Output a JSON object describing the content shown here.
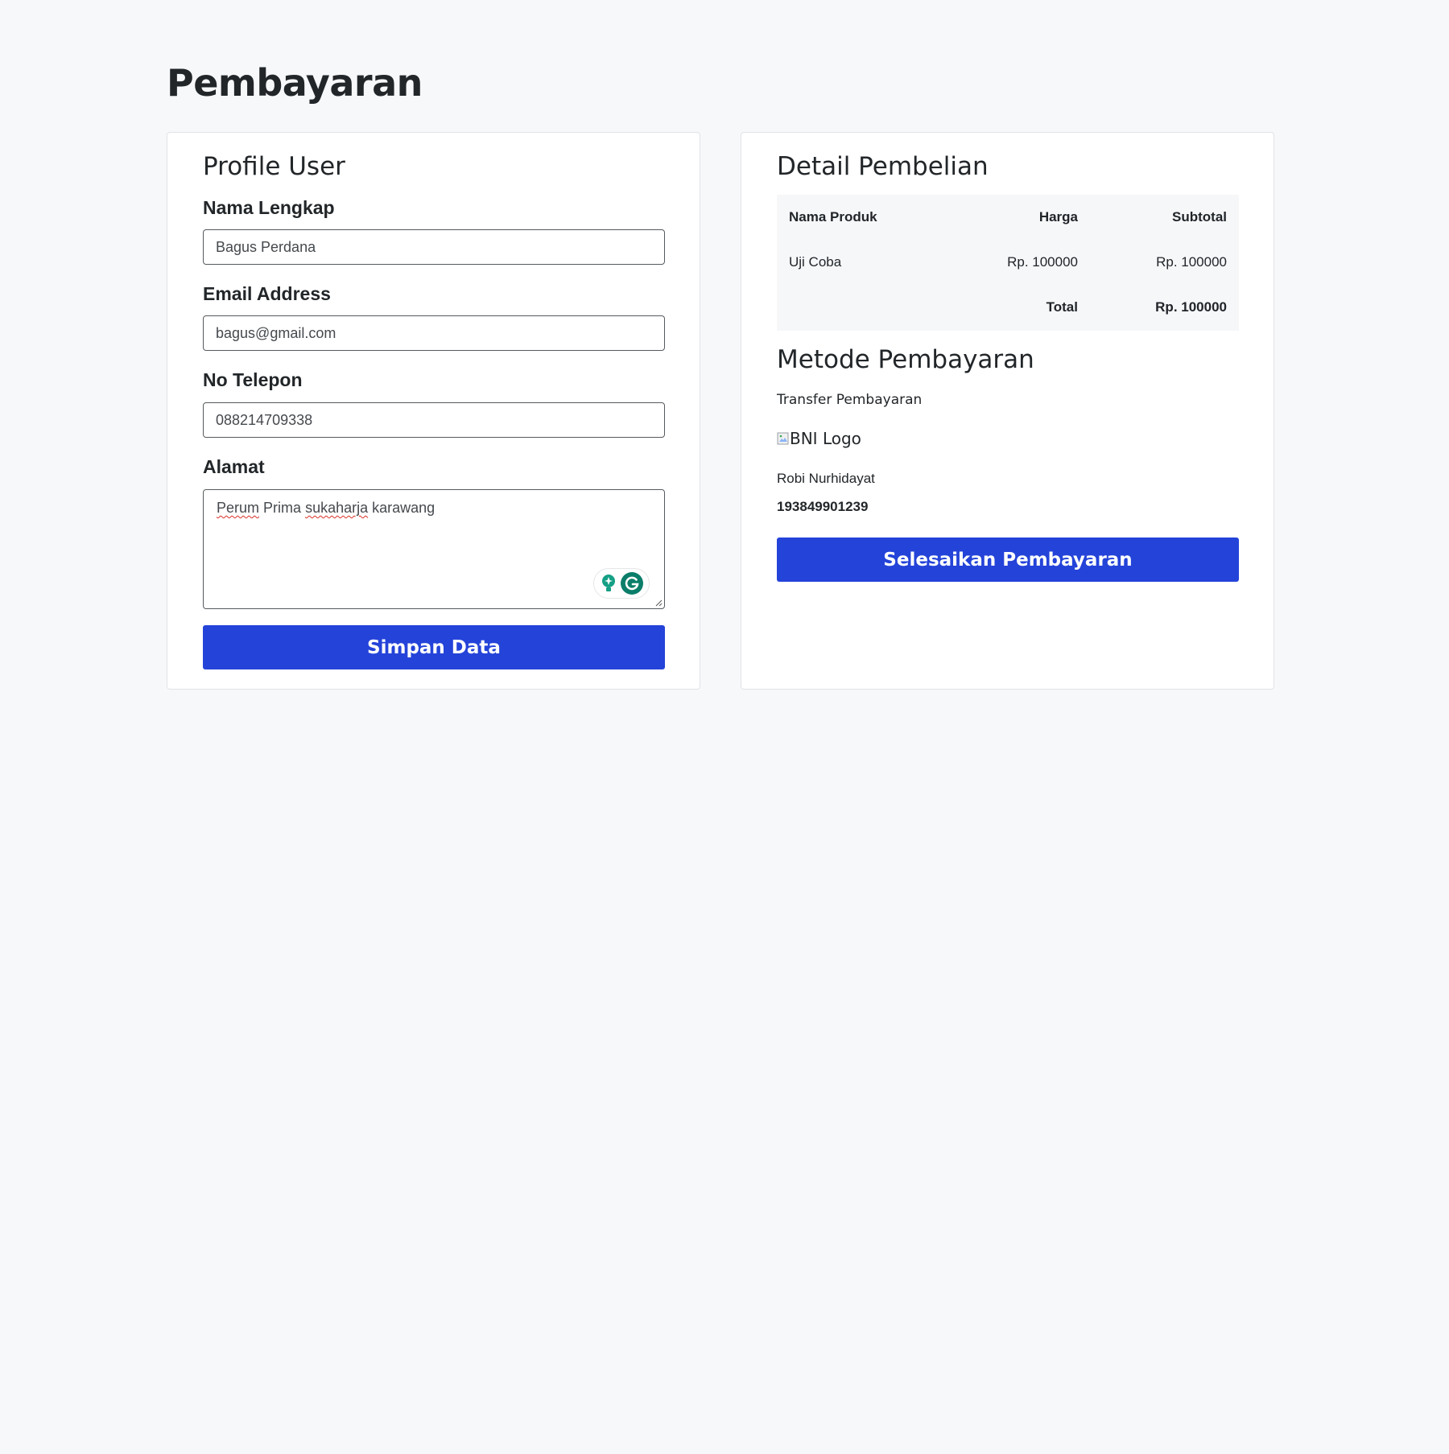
{
  "page": {
    "title": "Pembayaran"
  },
  "profile": {
    "title": "Profile User",
    "fields": {
      "name_label": "Nama Lengkap",
      "name_value": "Bagus Perdana",
      "email_label": "Email Address",
      "email_value": "bagus@gmail.com",
      "phone_label": "No Telepon",
      "phone_value": "088214709338",
      "address_label": "Alamat",
      "address_value": "Perum Prima sukaharja karawang",
      "address_words": [
        "Perum",
        "Prima",
        "sukaharja",
        "karawang"
      ]
    },
    "save_label": "Simpan Data"
  },
  "order": {
    "title": "Detail Pembelian",
    "columns": [
      "Nama Produk",
      "Harga",
      "Subtotal"
    ],
    "rows": [
      {
        "product": "Uji Coba",
        "price": "Rp. 100000",
        "subtotal": "Rp. 100000"
      }
    ],
    "total_label": "Total",
    "total_value": "Rp. 100000"
  },
  "payment": {
    "title": "Metode Pembayaran",
    "method": "Transfer Pembayaran",
    "bank_logo_alt": "BNI Logo",
    "account_name": "Robi Nurhidayat",
    "account_number": "193849901239",
    "finish_label": "Selesaikan Pembayaran"
  },
  "colors": {
    "primary": "#2443d9",
    "background": "#f7f8fa",
    "grammarly": "#15a085"
  },
  "icons": [
    "grammarly-suggestion-icon",
    "grammarly-logo-icon",
    "broken-image-icon",
    "resize-grip-icon"
  ]
}
